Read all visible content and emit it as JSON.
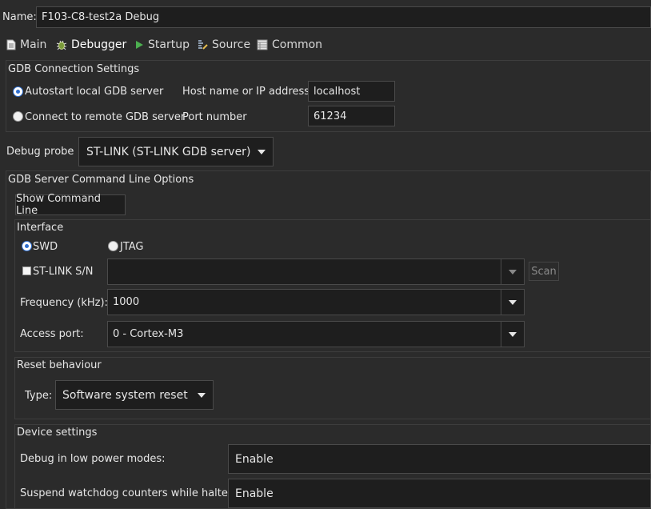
{
  "config": {
    "name_label": "Name:",
    "name_value": "F103-C8-test2a Debug"
  },
  "tabs": [
    {
      "label": "Main",
      "icon": "document-icon"
    },
    {
      "label": "Debugger",
      "icon": "bug-icon"
    },
    {
      "label": "Startup",
      "icon": "play-icon"
    },
    {
      "label": "Source",
      "icon": "source-icon"
    },
    {
      "label": "Common",
      "icon": "common-icon"
    }
  ],
  "gdb_connection": {
    "title": "GDB Connection Settings",
    "autostart_label": "Autostart local GDB server",
    "remote_label": "Connect to remote GDB server",
    "host_label": "Host name or IP address",
    "host_value": "localhost",
    "port_label": "Port number",
    "port_value": "61234"
  },
  "debug_probe": {
    "label": "Debug probe",
    "value": "ST-LINK (ST-LINK GDB server)"
  },
  "gdb_server_options": {
    "title": "GDB Server Command Line Options",
    "show_command_line_label": "Show Command Line"
  },
  "interface": {
    "title": "Interface",
    "swd_label": "SWD",
    "jtag_label": "JTAG",
    "stlink_sn_label": "ST-LINK S/N",
    "stlink_sn_value": "",
    "scan_label": "Scan",
    "frequency_label": "Frequency (kHz):",
    "frequency_value": "1000",
    "access_port_label": "Access port:",
    "access_port_value": "0 - Cortex-M3"
  },
  "reset_behaviour": {
    "title": "Reset behaviour",
    "type_label": "Type:",
    "type_value": "Software system reset"
  },
  "device_settings": {
    "title": "Device settings",
    "low_power_label": "Debug in low power modes:",
    "low_power_value": "Enable",
    "watchdog_label": "Suspend watchdog counters while halted:",
    "watchdog_value": "Enable"
  },
  "colors": {
    "background": "#2b2b2b",
    "field": "#1e1e1e",
    "border": "#4a4a4a",
    "radio_accent": "#2f6fd0",
    "play_icon": "#4caf50"
  }
}
